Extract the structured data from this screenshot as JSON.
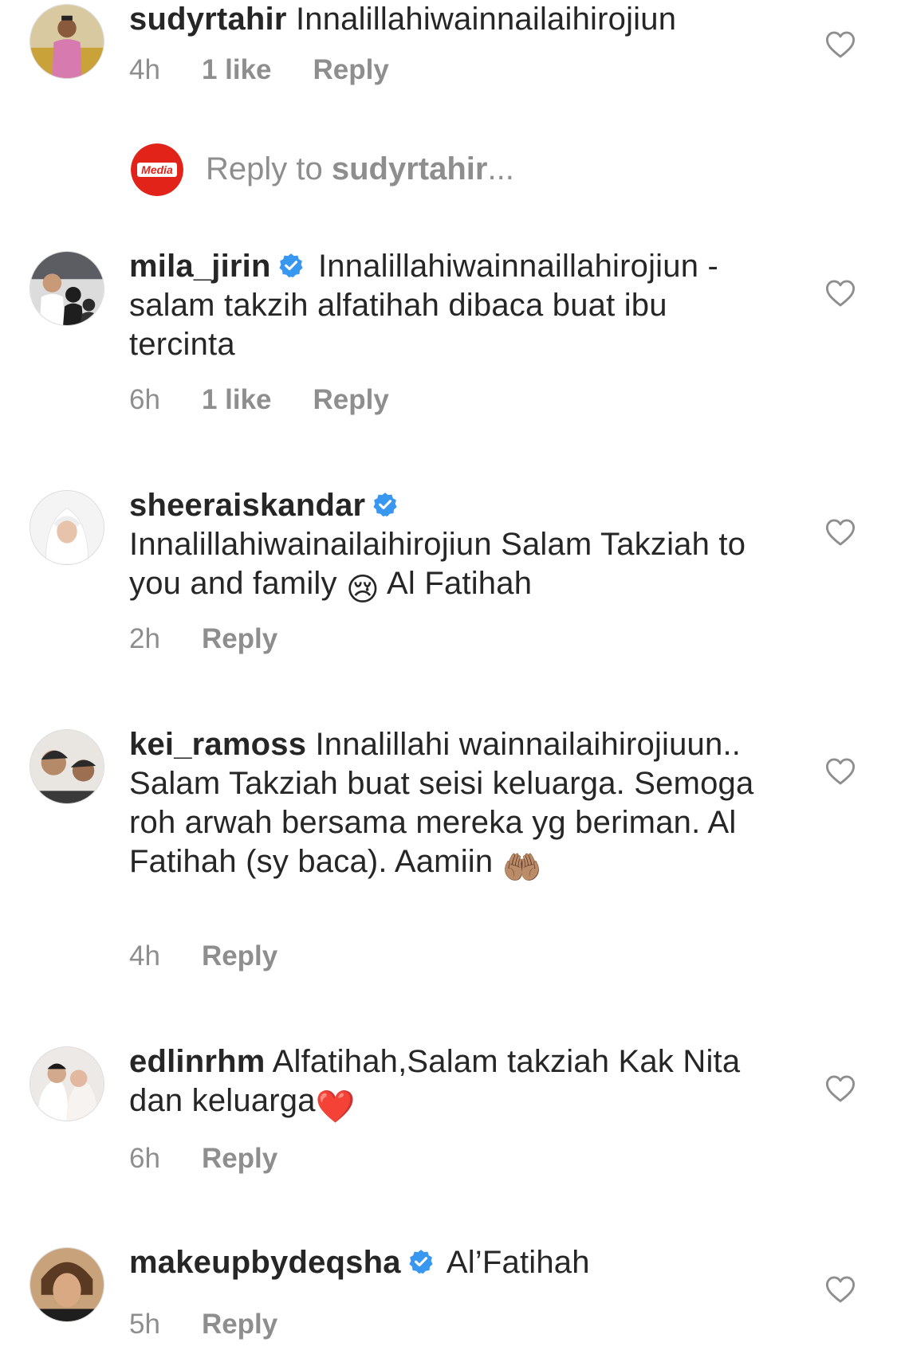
{
  "comments": [
    {
      "username": "sudyrtahir",
      "verified": false,
      "text": "Innalillahiwainnailaihirojiun",
      "time": "4h",
      "likes": "1 like",
      "reply": "Reply"
    },
    {
      "username": "mila_jirin",
      "verified": true,
      "text": "Innalillahiwainnaillahirojiun - salam takzih  alfatihah dibaca buat ibu tercinta",
      "time": "6h",
      "likes": "1 like",
      "reply": "Reply"
    },
    {
      "username": "sheeraiskandar",
      "verified": true,
      "text_before_emoji": "Innalillahiwainailaihirojiun Salam Takziah to you and family ",
      "emoji": "😢",
      "text_after_emoji": "  Al Fatihah",
      "time": "2h",
      "reply": "Reply"
    },
    {
      "username": "kei_ramoss",
      "verified": false,
      "text_before_emoji": "Innalillahi wainnailaihirojiuun.. Salam Takziah buat seisi keluarga. Semoga roh arwah bersama mereka yg beriman. Al Fatihah (sy baca). Aamiin ",
      "emoji": "🤲🏽",
      "time": "4h",
      "reply": "Reply"
    },
    {
      "username": "edlinrhm",
      "verified": false,
      "text_before_emoji": "Alfatihah,Salam takziah Kak Nita dan keluarga",
      "emoji": "❤️",
      "time": "6h",
      "reply": "Reply"
    },
    {
      "username": "makeupbydeqsha",
      "verified": true,
      "text": "Al’Fatihah",
      "time": "5h",
      "reply": "Reply"
    }
  ],
  "reply_composer": {
    "prefix": "Reply to ",
    "target": "sudyrtahir",
    "suffix": "...",
    "logo_text": "Media"
  },
  "colors": {
    "text": "#262626",
    "secondary": "#8e8e8e",
    "verified": "#3897f0",
    "logo_red": "#e2231a"
  }
}
